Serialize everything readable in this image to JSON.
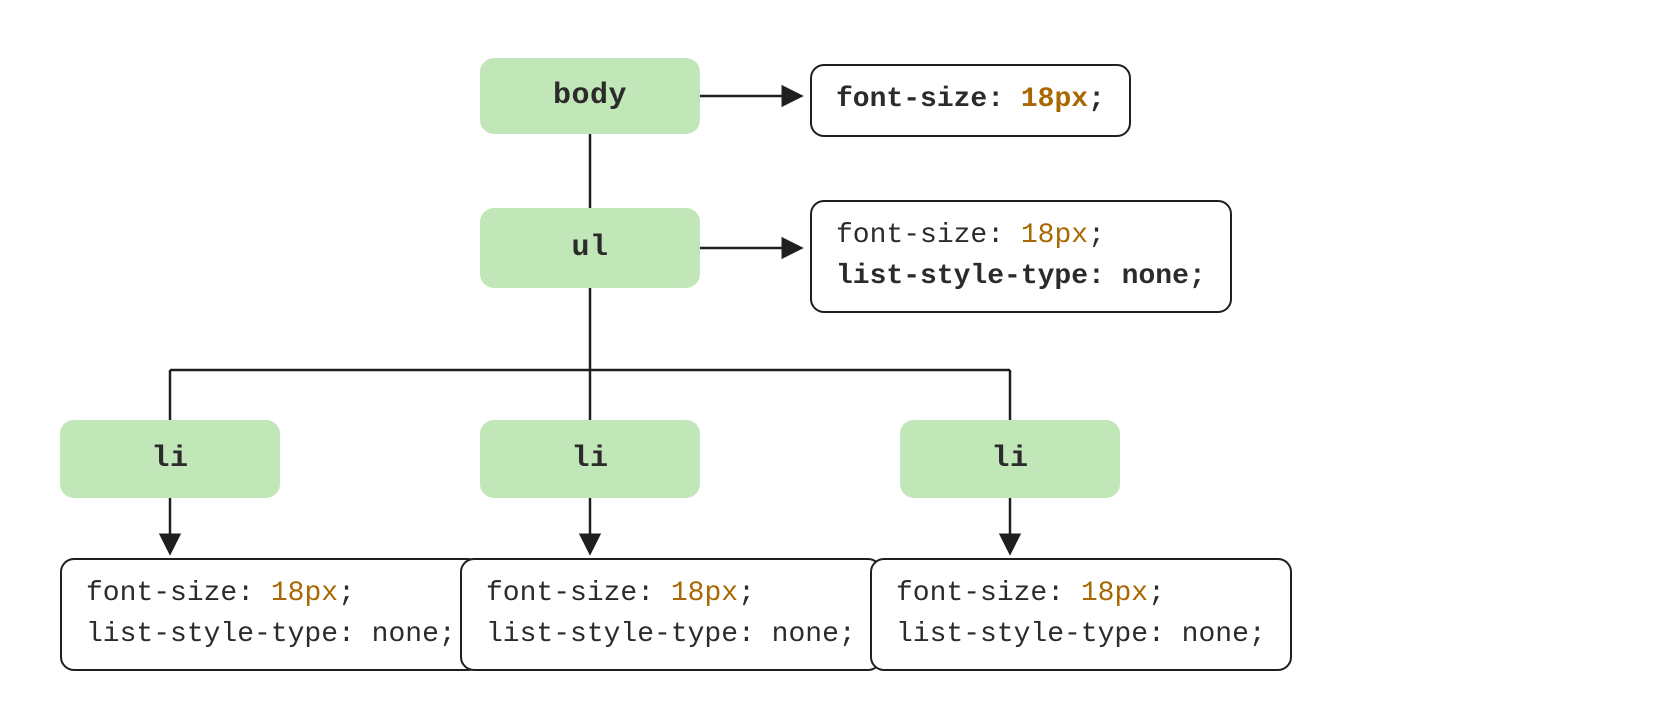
{
  "colors": {
    "node_fill": "#c1e6b7",
    "value_color": "#a86800",
    "text_color": "#2b2b2b",
    "border_color": "#1f1f1f"
  },
  "tree": {
    "body": {
      "label": "body",
      "rules": [
        {
          "prop": "font-size",
          "value": "18px",
          "bold": true
        }
      ]
    },
    "ul": {
      "label": "ul",
      "rules": [
        {
          "prop": "font-size",
          "value": "18px",
          "bold": false
        },
        {
          "prop": "list-style-type",
          "value": "none",
          "bold": true
        }
      ]
    },
    "li": [
      {
        "label": "li",
        "rules": [
          {
            "prop": "font-size",
            "value": "18px",
            "bold": false
          },
          {
            "prop": "list-style-type",
            "value": "none",
            "bold": false
          }
        ]
      },
      {
        "label": "li",
        "rules": [
          {
            "prop": "font-size",
            "value": "18px",
            "bold": false
          },
          {
            "prop": "list-style-type",
            "value": "none",
            "bold": false
          }
        ]
      },
      {
        "label": "li",
        "rules": [
          {
            "prop": "font-size",
            "value": "18px",
            "bold": false
          },
          {
            "prop": "list-style-type",
            "value": "none",
            "bold": false
          }
        ]
      }
    ]
  }
}
